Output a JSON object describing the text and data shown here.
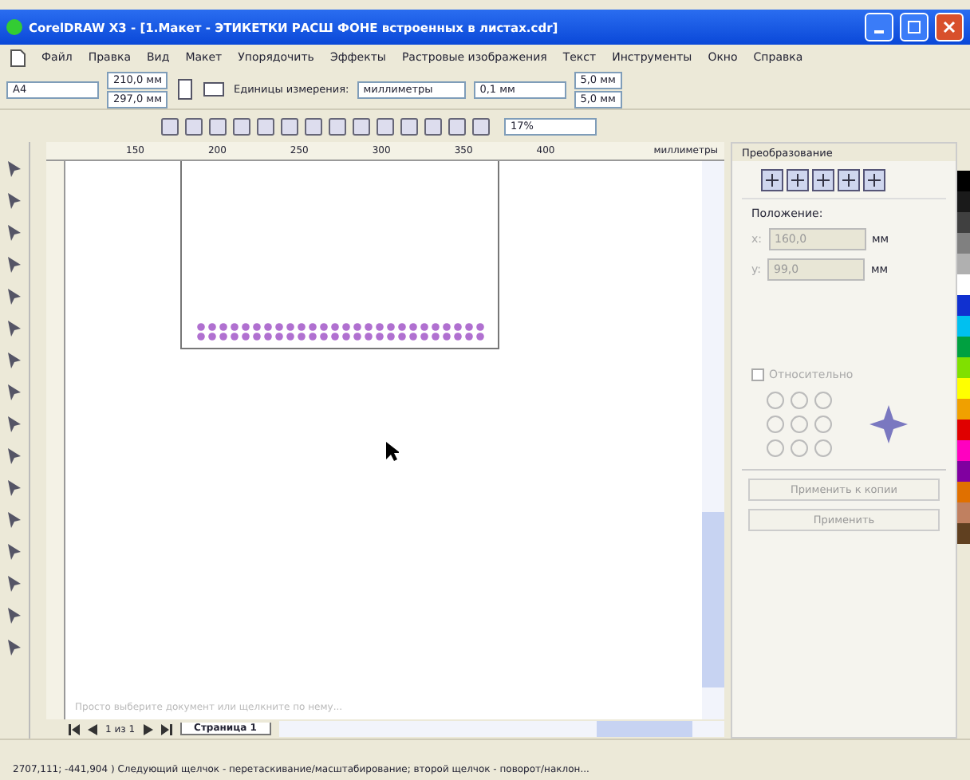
{
  "window": {
    "title": "CorelDRAW X3 - [1.Макет - ЭТИКЕТКИ РАСШ ФОНЕ встроенных в листах.cdr]"
  },
  "menu": [
    "Файл",
    "Правка",
    "Вид",
    "Макет",
    "Упорядочить",
    "Эффекты",
    "Растровые изображения",
    "Текст",
    "Инструменты",
    "Окно",
    "Справка"
  ],
  "property_bar": {
    "paper": "A4",
    "width": "210,0 мм",
    "height": "297,0 мм",
    "units_label": "Единицы измерения:",
    "units": "миллиметры",
    "nudge": "0,1 мм",
    "dup_x": "5,0 мм",
    "dup_y": "5,0 мм"
  },
  "standard_bar": {
    "zoom": "17%"
  },
  "ruler": {
    "ticks": [
      "150",
      "200",
      "250",
      "300",
      "350",
      "400"
    ],
    "unit": "миллиметры"
  },
  "docker": {
    "title": "Преобразование",
    "position_label": "Положение:",
    "fields": [
      {
        "axis": "x:",
        "value": "160,0",
        "unit": "мм"
      },
      {
        "axis": "y:",
        "value": "99,0",
        "unit": "мм"
      }
    ],
    "relative": {
      "label": "Относительно",
      "checked": false
    },
    "buttons": [
      "Применить к копии",
      "Применить"
    ]
  },
  "canvas": {
    "hint": "Просто выберите документ или щелкните по нему..."
  },
  "page_nav": {
    "counter": "1 из 1",
    "tabs": [
      {
        "label": "Страница 1",
        "selected": true
      }
    ]
  },
  "status_bar": {
    "text": "2707,111; -441,904 ) Следующий щелчок - перетаскивание/масштабирование; второй щелчок - поворот/наклон..."
  },
  "palette": [
    {
      "color": "#000000"
    },
    {
      "color": "#1a1a1a"
    },
    {
      "color": "#404040"
    },
    {
      "color": "#808080"
    },
    {
      "color": "#b0b0b0"
    },
    {
      "color": "#ffffff"
    },
    {
      "color": "#1030d0"
    },
    {
      "color": "#00c0f0"
    },
    {
      "color": "#00a040"
    },
    {
      "color": "#80e000"
    },
    {
      "color": "#ffff00"
    },
    {
      "color": "#f0a000"
    },
    {
      "color": "#e00000"
    },
    {
      "color": "#ff00c0"
    },
    {
      "color": "#8000a0"
    },
    {
      "color": "#e07000"
    },
    {
      "color": "#c08060"
    },
    {
      "color": "#604020"
    }
  ]
}
